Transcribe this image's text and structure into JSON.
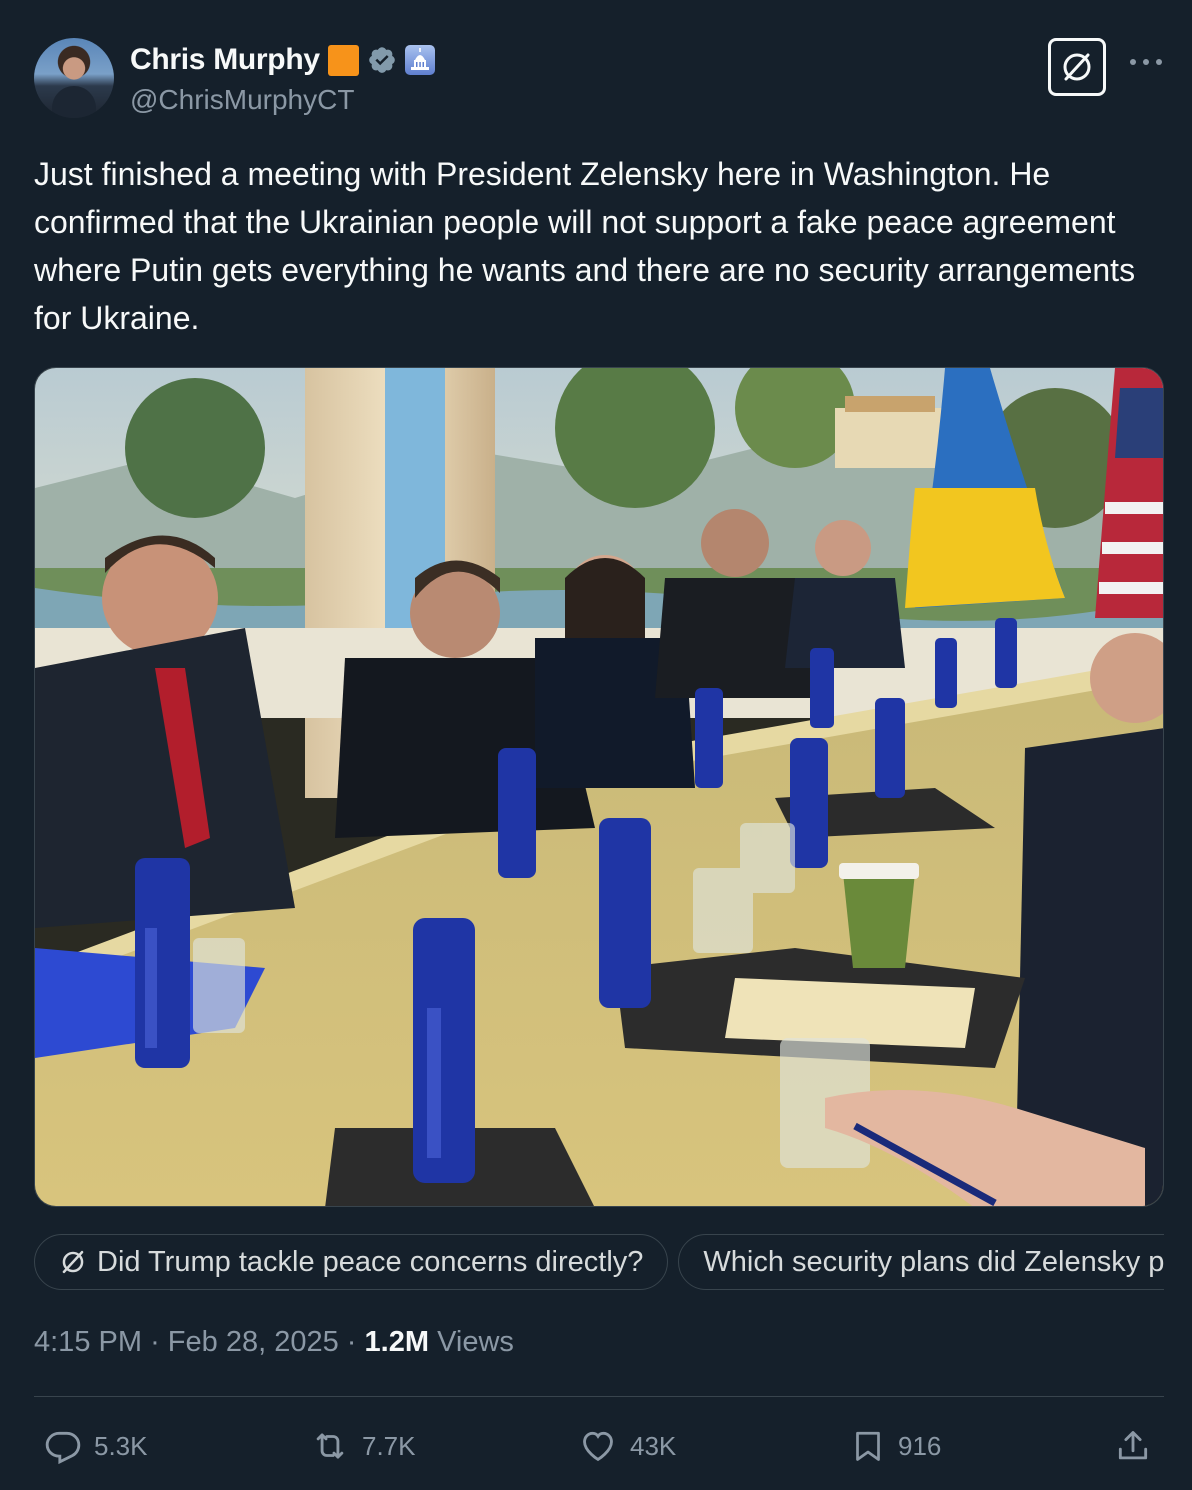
{
  "tweet": {
    "author": {
      "display_name": "Chris Murphy",
      "handle": "@ChrisMurphyCT"
    },
    "text": "Just finished a meeting with President Zelensky here in Washington. He confirmed that the Ukrainian people will not support a fake peace agreement where Putin gets everything he wants and there are no security arrangements for Ukraine.",
    "meta": {
      "time": "4:15 PM",
      "separator": "·",
      "date": "Feb 28, 2025",
      "views_count": "1.2M",
      "views_label": "Views"
    }
  },
  "grok_suggestions": [
    "Did Trump tackle peace concerns directly?",
    "Which security plans did Zelensky propose?"
  ],
  "actions": {
    "replies": "5.3K",
    "reposts": "7.7K",
    "likes": "43K",
    "bookmarks": "916"
  },
  "colors": {
    "background": "#15202b",
    "text_primary": "#f7f9f9",
    "text_secondary": "#8b98a5",
    "border": "#38444d",
    "verified": "#829aab",
    "badge_orange": "#f7931a"
  },
  "icons": [
    "avatar",
    "orange-square-badge",
    "verified-badge-icon",
    "capitol-icon",
    "grok-icon",
    "more-icon",
    "reply-icon",
    "repost-icon",
    "like-icon",
    "bookmark-icon",
    "share-icon"
  ]
}
